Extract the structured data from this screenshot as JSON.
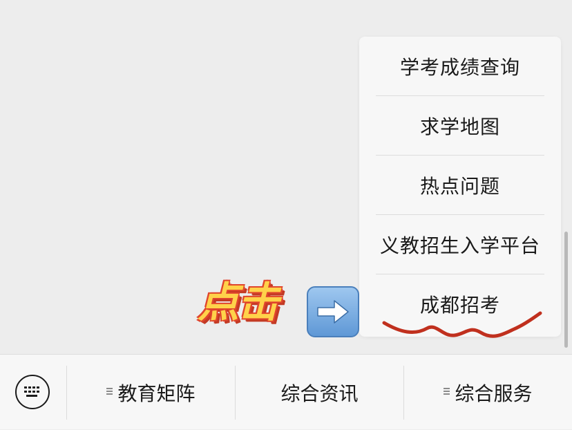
{
  "popup_menu": {
    "items": [
      {
        "label": "学考成绩查询"
      },
      {
        "label": "求学地图"
      },
      {
        "label": "热点问题"
      },
      {
        "label": "义教招生入学平台"
      },
      {
        "label": "成都招考"
      }
    ]
  },
  "annotation": {
    "text": "点击",
    "arrow_icon": "right-arrow-icon",
    "text_color": "#ffd24a",
    "outline_color": "#e0452d",
    "underline_color": "#c0301e"
  },
  "bottom_bar": {
    "keyboard_icon": "keyboard-icon",
    "tabs": [
      {
        "label": "教育矩阵",
        "has_submenu": true
      },
      {
        "label": "综合资讯",
        "has_submenu": false
      },
      {
        "label": "综合服务",
        "has_submenu": true
      }
    ]
  }
}
